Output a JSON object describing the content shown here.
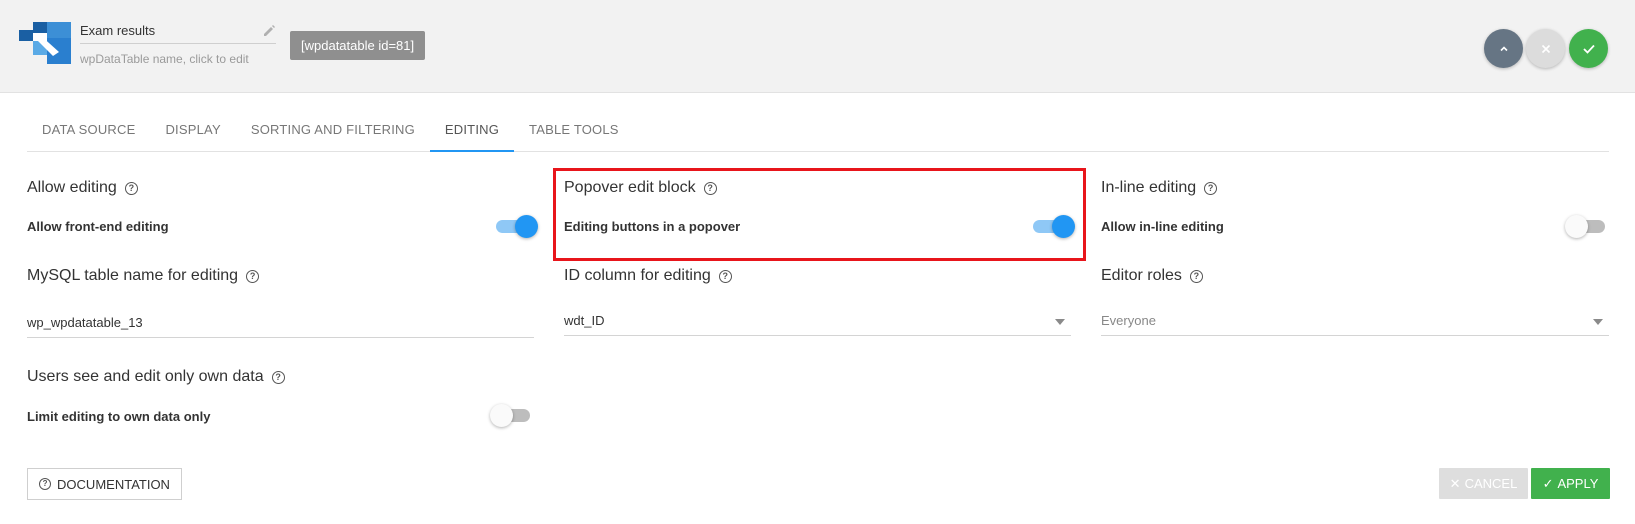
{
  "header": {
    "table_title": "Exam results",
    "title_hint": "wpDataTable name, click to edit",
    "shortcode": "[wpdatatable id=81]"
  },
  "tabs": [
    {
      "label": "DATA SOURCE",
      "active": false
    },
    {
      "label": "DISPLAY",
      "active": false
    },
    {
      "label": "SORTING AND FILTERING",
      "active": false
    },
    {
      "label": "EDITING",
      "active": true
    },
    {
      "label": "TABLE TOOLS",
      "active": false
    }
  ],
  "editing": {
    "allow_editing": {
      "title": "Allow editing",
      "label": "Allow front-end editing",
      "enabled": true
    },
    "popover": {
      "title": "Popover edit block",
      "label": "Editing buttons in a popover",
      "enabled": true
    },
    "inline": {
      "title": "In-line editing",
      "label": "Allow in-line editing",
      "enabled": false
    },
    "mysql_table": {
      "title": "MySQL table name for editing",
      "value": "wp_wpdatatable_13"
    },
    "id_column": {
      "title": "ID column for editing",
      "value": "wdt_ID"
    },
    "editor_roles": {
      "title": "Editor roles",
      "value": "Everyone"
    },
    "own_data": {
      "title": "Users see and edit only own data",
      "label": "Limit editing to own data only",
      "enabled": false
    }
  },
  "footer": {
    "documentation": "DOCUMENTATION",
    "cancel": "CANCEL",
    "apply": "APPLY"
  },
  "colors": {
    "accent": "#2196f3",
    "success": "#41b14d",
    "highlight": "#e8151b",
    "collapse_button": "#667584"
  }
}
